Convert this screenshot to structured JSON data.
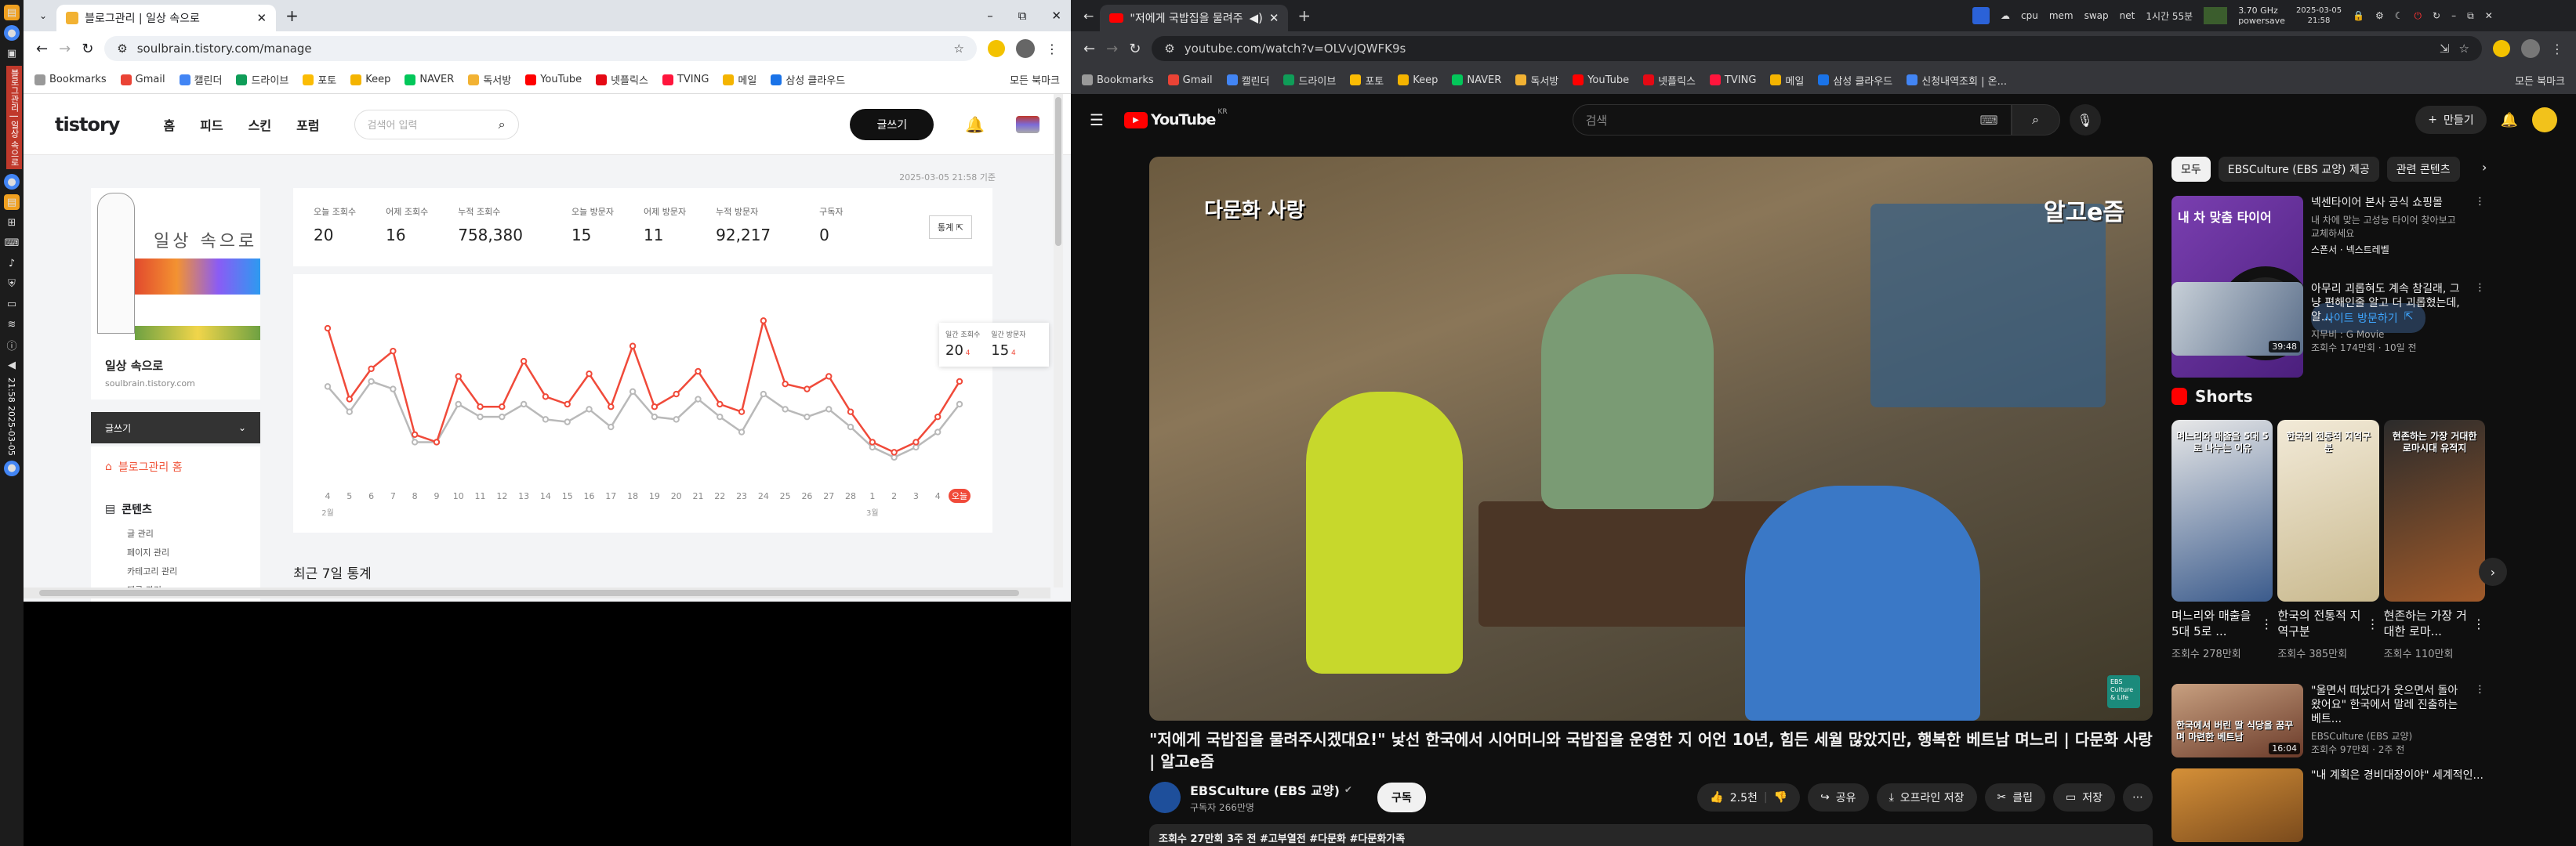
{
  "tistory": {
    "tab_title": "블로그관리 | 일상 속으로",
    "url": "soulbrain.tistory.com/manage",
    "bookmarks": [
      "Bookmarks",
      "Gmail",
      "캘린더",
      "드라이브",
      "포토",
      "Keep",
      "NAVER",
      "독서방",
      "YouTube",
      "넷플릭스",
      "TVING",
      "메일",
      "삼성 클라우드"
    ],
    "bookmarks_right": "모든 북마크",
    "header": {
      "logo": "tistory",
      "nav": [
        "홈",
        "피드",
        "스킨",
        "포럼"
      ],
      "search_placeholder": "검색어 입력",
      "write": "글쓰기"
    },
    "timestamp": "2025-03-05 21:58 기준",
    "blog": {
      "title_image_text": "일상 속으로",
      "name": "일상 속으로",
      "url": "soulbrain.tistory.com",
      "write": "글쓰기",
      "home": "블로그관리 홈",
      "section": "콘텐츠",
      "items": [
        "글 관리",
        "페이지 관리",
        "카테고리 관리",
        "댓글 관리"
      ]
    },
    "stats": [
      {
        "label": "오늘 조회수",
        "value": "20"
      },
      {
        "label": "어제 조회수",
        "value": "16"
      },
      {
        "label": "누적 조회수",
        "value": "758,380"
      },
      {
        "label": "오늘 방문자",
        "value": "15"
      },
      {
        "label": "어제 방문자",
        "value": "11"
      },
      {
        "label": "누적 방문자",
        "value": "92,217"
      },
      {
        "label": "구독자",
        "value": "0"
      }
    ],
    "stats_button": "통계",
    "tooltip": {
      "views_label": "일간 조회수",
      "views": "20",
      "views_delta": "4",
      "visitors_label": "일간 방문자",
      "visitors": "15",
      "visitors_delta": "4"
    },
    "recent_title": "최근 7일 통계",
    "month_labels": {
      "feb": "2월",
      "mar": "3월"
    }
  },
  "chart_data": {
    "type": "line",
    "categories": [
      "4",
      "5",
      "6",
      "7",
      "8",
      "9",
      "10",
      "11",
      "12",
      "13",
      "14",
      "15",
      "16",
      "17",
      "18",
      "19",
      "20",
      "21",
      "22",
      "23",
      "24",
      "25",
      "26",
      "27",
      "28",
      "1",
      "2",
      "3",
      "4",
      "오늘"
    ],
    "series": [
      {
        "name": "일간 조회수",
        "color": "#f04a3a",
        "values": [
          56,
          28,
          40,
          47,
          14,
          11,
          37,
          25,
          25,
          43,
          29,
          26,
          38,
          25,
          49,
          25,
          30,
          39,
          26,
          23,
          59,
          34,
          32,
          37,
          23,
          11,
          7,
          11,
          21,
          35
        ]
      },
      {
        "name": "일간 방문자",
        "color": "#b9b9b9",
        "values": [
          33,
          23,
          35,
          32,
          11,
          11,
          26,
          21,
          21,
          26,
          20,
          19,
          24,
          17,
          31,
          21,
          20,
          28,
          21,
          15,
          30,
          24,
          21,
          24,
          17,
          9,
          5,
          9,
          15,
          26
        ]
      }
    ],
    "ylim": [
      0,
      65
    ]
  },
  "youtube": {
    "tab_title": "\"저에게 국밥집을 물려주시겠대요!\"",
    "url": "youtube.com/watch?v=OLVvJQWFK9s",
    "bookmarks": [
      "Bookmarks",
      "Gmail",
      "캘린더",
      "드라이브",
      "포토",
      "Keep",
      "NAVER",
      "독서방",
      "YouTube",
      "넷플릭스",
      "TVING",
      "메일",
      "삼성 클라우드",
      "신청내역조회 | 온..."
    ],
    "bookmarks_right": "모든 북마크",
    "logo": "YouTube",
    "logo_region": "KR",
    "search_placeholder": "검색",
    "create": "만들기",
    "video_overlay_left": "다문화 사랑",
    "video_overlay_right": "알고e즘",
    "channel_badge": "EBS Culture & Life",
    "video_title": "\"저에게 국밥집을 물려주시겠대요!\" 낯선 한국에서 시어머니와 국밥집을 운영한 지 어언 10년, 힘든 세월 많았지만, 행복한 베트남 며느리 | 다문화 사랑 | 알고e즘",
    "channel": "EBSCulture (EBS 교양)",
    "subscribers": "구독자 266만명",
    "subscribe": "구독",
    "likes": "2.5천",
    "share": "공유",
    "download": "오프라인 저장",
    "clip": "클립",
    "save": "저장",
    "meta": "조회수 27만회  3주 전  #고부열전 #다문화 #다문화가족",
    "chips": [
      "모두",
      "EBSCulture (EBS 교양) 제공",
      "관련 콘텐츠"
    ],
    "ad": {
      "title": "넥센타이어 본사 공식 쇼핑몰",
      "desc": "내 차에 맞는 고성능 타이어 찾아보고 교체하세요",
      "sponsor": "스폰서 · 넥스트레벨",
      "cta": "사이트 방문하기",
      "thumb_text": "내 차 맞춤 타이어"
    },
    "rec1": {
      "title": "아무리 괴롭혀도 계속 참길래, 그냥 편해인줄 알고 더 괴롭혔는데, 알...",
      "channel": "지무비 : G Movie",
      "meta": "조회수 174만회 · 10일 전",
      "duration": "39:48"
    },
    "shorts_title": "Shorts",
    "shorts": [
      {
        "title": "며느리와 매출을 5대 5로 ...",
        "views": "조회수 278만회",
        "thumb": "며느리와 매출을 5대 5로 나누는 이유"
      },
      {
        "title": "한국의 전통적 지역구분",
        "views": "조회수 385만회",
        "thumb": "한국의 전통적 지역구분"
      },
      {
        "title": "현존하는 가장 거대한 로마...",
        "views": "조회수 110만회",
        "thumb": "현존하는 가장 거대한 로마시대 유적지"
      }
    ],
    "rec2": {
      "title": "\"울면서 떠났다가 웃으면서 돌아왔어요\" 한국에서 말레 진출하는 베트...",
      "channel": "EBSCulture (EBS 교양)",
      "meta": "조회수 97만회 · 2주 전",
      "duration": "16:04",
      "thumb": "한국에서 버린 딸 식당을 꿈꾸며 마련한 베트남"
    },
    "rec3": {
      "title": "\"내 계획은 경비대장이야\" 세계적인..."
    }
  },
  "system": {
    "cpu": "cpu",
    "mem": "mem",
    "swap": "swap",
    "net": "net",
    "uptime": "1시간 55분",
    "freq": "3.70 GHz",
    "mode": "powersave",
    "date": "2025-03-05",
    "time": "21:58"
  },
  "sidebar": {
    "vertical_text": "블로그관리 | 일상 속으로",
    "date_text": "2025-03-05",
    "time_text": "21:58"
  }
}
